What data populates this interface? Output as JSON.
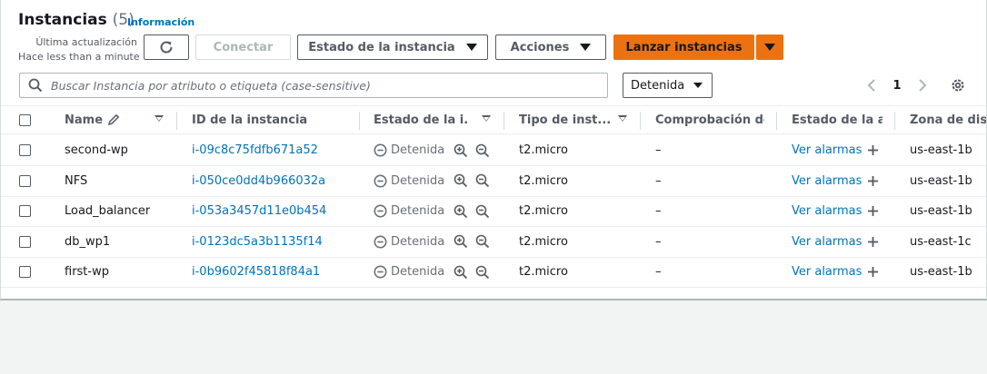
{
  "header": {
    "title": "Instancias",
    "count": "(5)",
    "info_link": "Información",
    "last_update_line1": "Última actualización",
    "last_update_line2": "Hace less than a minute"
  },
  "toolbar": {
    "connect_label": "Conectar",
    "instance_state_label": "Estado de la instancia",
    "actions_label": "Acciones",
    "launch_label": "Lanzar instancias"
  },
  "filter": {
    "search_placeholder": "Buscar Instancia por atributo o etiqueta (case-sensitive)",
    "state_filter_value": "Detenida"
  },
  "pagination": {
    "current_page": "1"
  },
  "table": {
    "columns": {
      "name": "Name",
      "instance_id": "ID de la instancia",
      "instance_state": "Estado de la i...",
      "instance_type": "Tipo de inst...",
      "status_check": "Comprobación de",
      "alarm_status": "Estado de la ala",
      "availability_zone": "Zona de dispo"
    },
    "rows": [
      {
        "name": "second-wp",
        "instance_id": "i-09c8c75fdfb671a52",
        "state": "Detenida",
        "type": "t2.micro",
        "check": "–",
        "alarm": "Ver alarmas",
        "zone": "us-east-1b"
      },
      {
        "name": "NFS",
        "instance_id": "i-050ce0dd4b966032a",
        "state": "Detenida",
        "type": "t2.micro",
        "check": "–",
        "alarm": "Ver alarmas",
        "zone": "us-east-1b"
      },
      {
        "name": "Load_balancer",
        "instance_id": "i-053a3457d11e0b454",
        "state": "Detenida",
        "type": "t2.micro",
        "check": "–",
        "alarm": "Ver alarmas",
        "zone": "us-east-1b"
      },
      {
        "name": "db_wp1",
        "instance_id": "i-0123dc5a3b1135f14",
        "state": "Detenida",
        "type": "t2.micro",
        "check": "–",
        "alarm": "Ver alarmas",
        "zone": "us-east-1c"
      },
      {
        "name": "first-wp",
        "instance_id": "i-0b9602f45818f84a1",
        "state": "Detenida",
        "type": "t2.micro",
        "check": "–",
        "alarm": "Ver alarmas",
        "zone": "us-east-1b"
      }
    ]
  },
  "colors": {
    "link": "#0073bb",
    "primary_button": "#ec7211",
    "muted_text": "#687078"
  }
}
